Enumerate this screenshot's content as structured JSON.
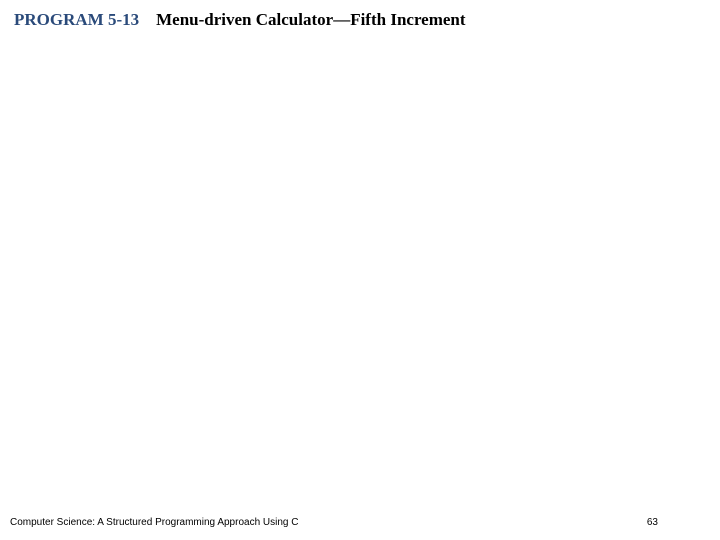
{
  "header": {
    "program_label": "PROGRAM 5-13",
    "program_title": "Menu-driven Calculator—Fifth Increment"
  },
  "footer": {
    "book_title": "Computer Science: A Structured Programming Approach Using C",
    "page_number": "63"
  }
}
